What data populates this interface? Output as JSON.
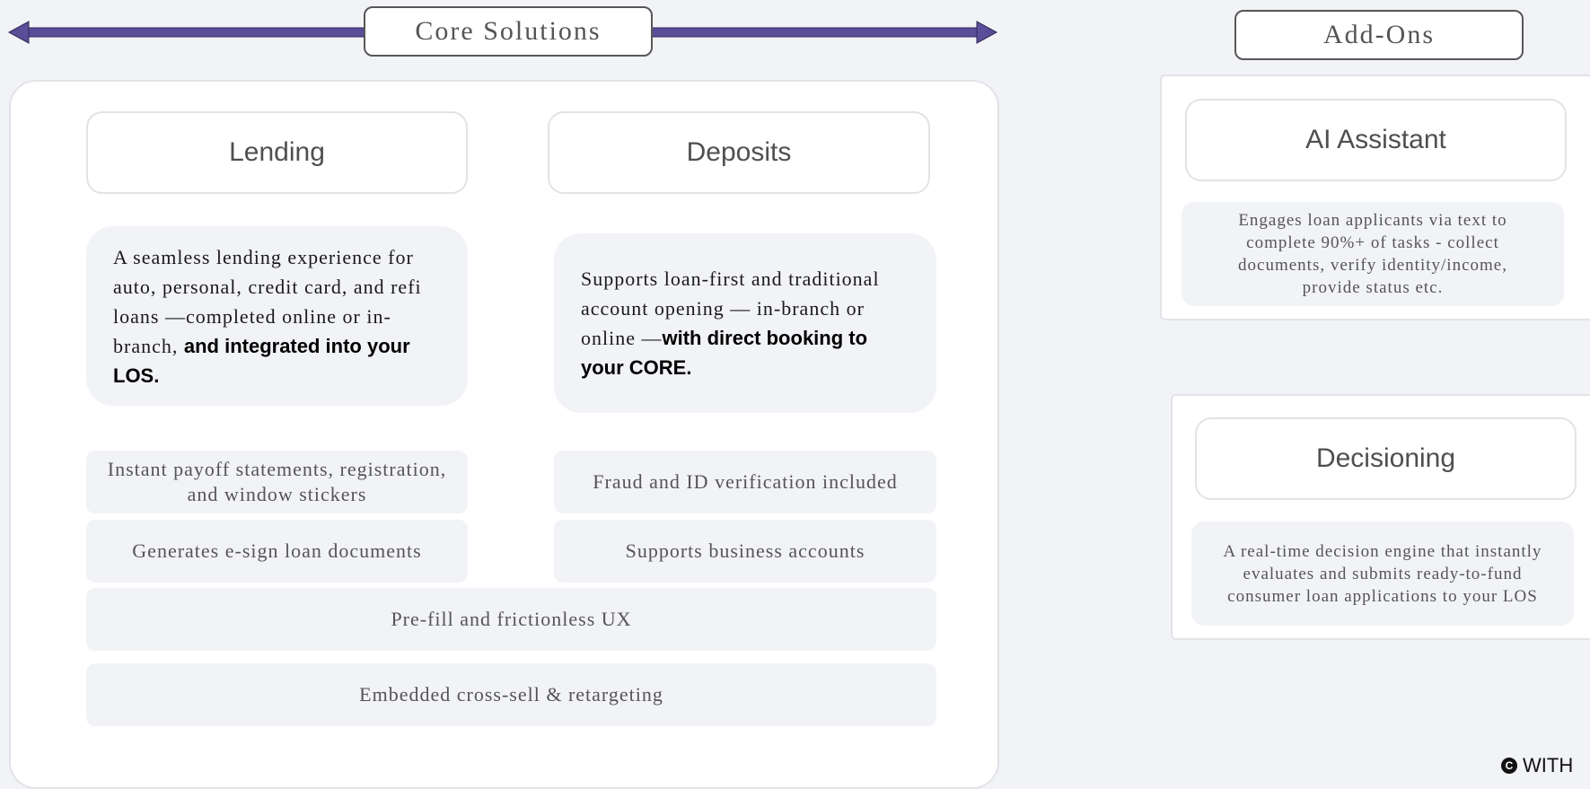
{
  "core": {
    "title": "Core Solutions",
    "lending": {
      "header": "Lending",
      "desc_plain": "A seamless lending experience for auto, personal, credit card, and refi loans —completed online or in-branch, ",
      "desc_bold": "and integrated into your LOS."
    },
    "deposits": {
      "header": "Deposits",
      "desc_plain": "Supports loan-first and traditional account opening — in-branch or online —",
      "desc_bold": "with direct booking to your CORE."
    },
    "features": {
      "payoff": "Instant payoff statements, registration, and window stickers",
      "esign": "Generates e-sign loan documents",
      "fraud": "Fraud and ID verification included",
      "business": "Supports business accounts",
      "prefill": "Pre-fill and frictionless UX",
      "crosssell": "Embedded cross-sell & retargeting"
    }
  },
  "addons": {
    "title": "Add-Ons",
    "ai": {
      "header": "AI Assistant",
      "desc": "Engages loan applicants via text to complete 90%+ of tasks - collect documents, verify identity/income, provide status etc."
    },
    "decisioning": {
      "header": "Decisioning",
      "desc": "A real-time decision engine that instantly evaluates and submits ready-to-fund consumer loan applications to your LOS"
    }
  },
  "watermark": {
    "icon": "c-logo-icon",
    "text": "WITH"
  },
  "colors": {
    "arrow": "#5b4d9a",
    "background": "#f2f3f7"
  }
}
